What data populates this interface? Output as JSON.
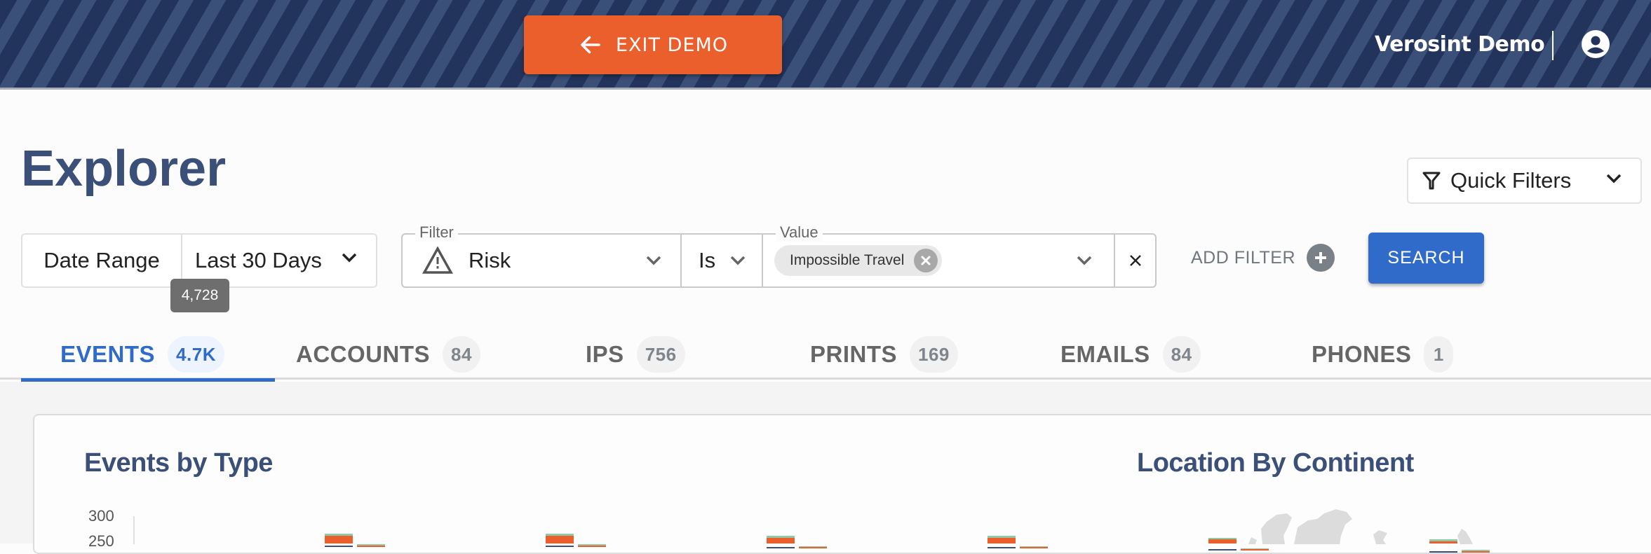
{
  "banner": {
    "exit_label": "EXIT DEMO",
    "org_name": "Verosint Demo",
    "colors": {
      "stripe_dark": "#22335c",
      "stripe_light": "#3b5079",
      "exit_button": "#ea5f2c"
    }
  },
  "page": {
    "title": "Explorer",
    "quick_filters_label": "Quick Filters"
  },
  "date_range": {
    "label": "Date Range",
    "value": "Last 30 Days",
    "tooltip": "4,728"
  },
  "filter": {
    "filter_legend": "Filter",
    "filter_value": "Risk",
    "operator": "Is",
    "value_legend": "Value",
    "chips": [
      "Impossible Travel"
    ]
  },
  "actions": {
    "add_filter_label": "ADD FILTER",
    "search_label": "SEARCH"
  },
  "tabs": [
    {
      "label": "EVENTS",
      "count": "4.7K",
      "active": true
    },
    {
      "label": "ACCOUNTS",
      "count": "84",
      "active": false
    },
    {
      "label": "IPS",
      "count": "756",
      "active": false
    },
    {
      "label": "PRINTS",
      "count": "169",
      "active": false
    },
    {
      "label": "EMAILS",
      "count": "84",
      "active": false
    },
    {
      "label": "PHONES",
      "count": "1",
      "active": false
    }
  ],
  "cards": {
    "events_title": "Events by Type",
    "location_title": "Location By Continent"
  },
  "chart_data": {
    "type": "bar",
    "title": "Events by Type",
    "yticks": [
      "300",
      "250"
    ],
    "ylim_visible": [
      250,
      300
    ],
    "series_colors": {
      "primary": "#3b5079",
      "secondary": "#ea5f2c",
      "tertiary": "#8fc9a5"
    },
    "groups": [
      {
        "stack": [
          {
            "color": "primary",
            "value": 270
          },
          {
            "color": "secondary",
            "value": 10
          },
          {
            "color": "tertiary",
            "value": 2
          }
        ],
        "side": [
          {
            "color": "secondary",
            "value": 270
          },
          {
            "color": "tertiary",
            "value": 1
          }
        ]
      },
      {
        "stack": [
          {
            "color": "primary",
            "value": 270
          },
          {
            "color": "secondary",
            "value": 10
          },
          {
            "color": "tertiary",
            "value": 2
          }
        ],
        "side": [
          {
            "color": "secondary",
            "value": 270
          },
          {
            "color": "tertiary",
            "value": 1
          }
        ]
      },
      {
        "stack": [
          {
            "color": "primary",
            "value": 268
          },
          {
            "color": "secondary",
            "value": 10
          },
          {
            "color": "tertiary",
            "value": 2
          }
        ],
        "side": [
          {
            "color": "secondary",
            "value": 268
          },
          {
            "color": "tertiary",
            "value": 1
          }
        ]
      },
      {
        "stack": [
          {
            "color": "primary",
            "value": 268
          },
          {
            "color": "secondary",
            "value": 10
          },
          {
            "color": "tertiary",
            "value": 2
          }
        ],
        "side": [
          {
            "color": "secondary",
            "value": 268
          },
          {
            "color": "tertiary",
            "value": 1
          }
        ]
      },
      {
        "stack": [
          {
            "color": "primary",
            "value": 266
          },
          {
            "color": "secondary",
            "value": 10
          },
          {
            "color": "tertiary",
            "value": 2
          }
        ],
        "side": [
          {
            "color": "secondary",
            "value": 266
          },
          {
            "color": "tertiary",
            "value": 1
          }
        ]
      },
      {
        "stack": [
          {
            "color": "primary",
            "value": 264
          },
          {
            "color": "secondary",
            "value": 10
          },
          {
            "color": "tertiary",
            "value": 2
          }
        ],
        "side": [
          {
            "color": "secondary",
            "value": 264
          },
          {
            "color": "tertiary",
            "value": 1
          }
        ]
      }
    ]
  }
}
